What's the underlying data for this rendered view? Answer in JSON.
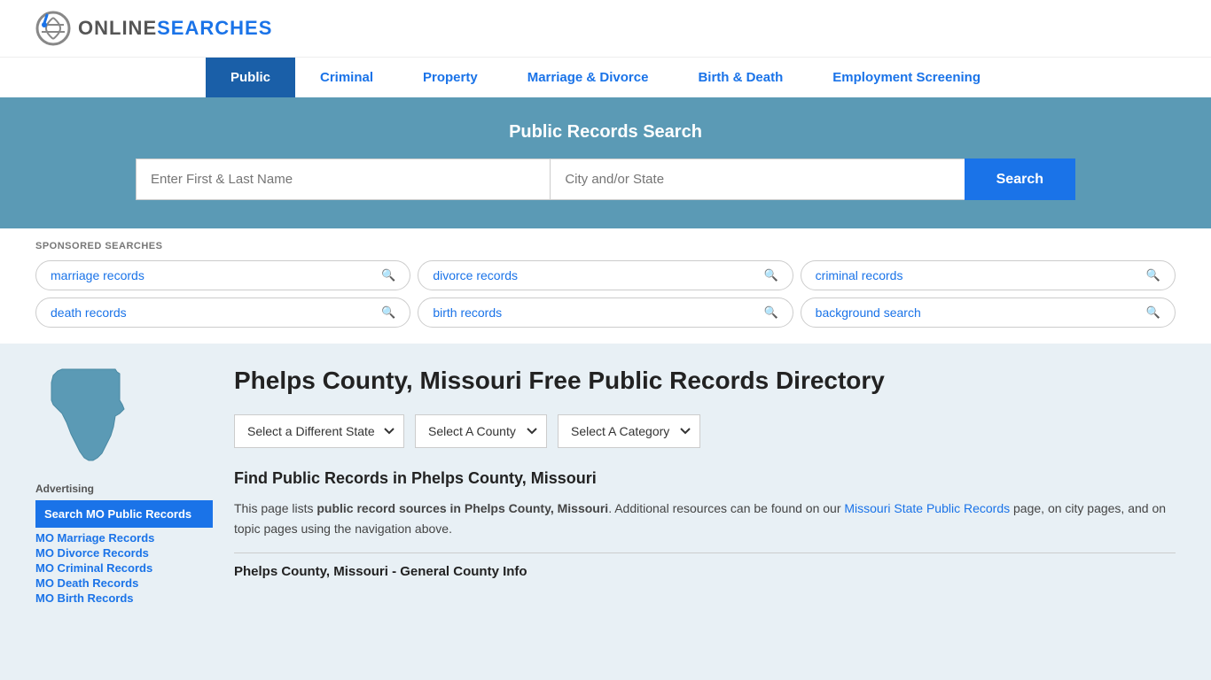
{
  "header": {
    "logo_online": "ONLINE",
    "logo_searches": "SEARCHES"
  },
  "nav": {
    "items": [
      {
        "label": "Public",
        "active": true
      },
      {
        "label": "Criminal",
        "active": false
      },
      {
        "label": "Property",
        "active": false
      },
      {
        "label": "Marriage & Divorce",
        "active": false
      },
      {
        "label": "Birth & Death",
        "active": false
      },
      {
        "label": "Employment Screening",
        "active": false
      }
    ]
  },
  "search_banner": {
    "title": "Public Records Search",
    "name_placeholder": "Enter First & Last Name",
    "location_placeholder": "City and/or State",
    "search_button_label": "Search"
  },
  "sponsored": {
    "label": "SPONSORED SEARCHES",
    "tags": [
      "marriage records",
      "divorce records",
      "criminal records",
      "death records",
      "birth records",
      "background search"
    ]
  },
  "page_title": "Phelps County, Missouri Free Public Records Directory",
  "dropdowns": {
    "state_label": "Select a Different State",
    "county_label": "Select A County",
    "category_label": "Select A Category"
  },
  "find_records_title": "Find Public Records in Phelps County, Missouri",
  "description": {
    "text_before_bold": "This page lists ",
    "bold_text": "public record sources in Phelps County, Missouri",
    "text_after_bold": ". Additional resources can be found on our ",
    "link_text": "Missouri State Public Records",
    "text_end": " page, on city pages, and on topic pages using the navigation above."
  },
  "general_info_title": "Phelps County, Missouri - General County Info",
  "sidebar": {
    "advertising_label": "Advertising",
    "ad_highlight": "Search MO Public Records",
    "links": [
      "MO Marriage Records",
      "MO Divorce Records",
      "MO Criminal Records",
      "MO Death Records",
      "MO Birth Records"
    ]
  }
}
